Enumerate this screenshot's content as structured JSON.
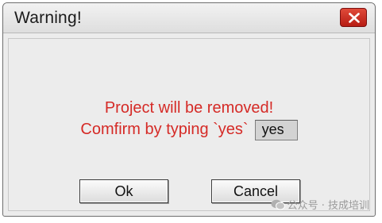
{
  "window": {
    "title": "Warning!"
  },
  "message": {
    "line1": "Project will be removed!",
    "line2": "Comfirm by typing `yes`"
  },
  "confirm_input": {
    "value": "yes"
  },
  "buttons": {
    "ok_label": "Ok",
    "cancel_label": "Cancel"
  },
  "watermark": {
    "text": "公众号 · 技成培训"
  },
  "colors": {
    "message_text": "#d52a26",
    "close_button": "#c8281c",
    "dialog_bg": "#ececec"
  },
  "icons": {
    "close": "close-icon",
    "watermark": "wechat-icon"
  }
}
